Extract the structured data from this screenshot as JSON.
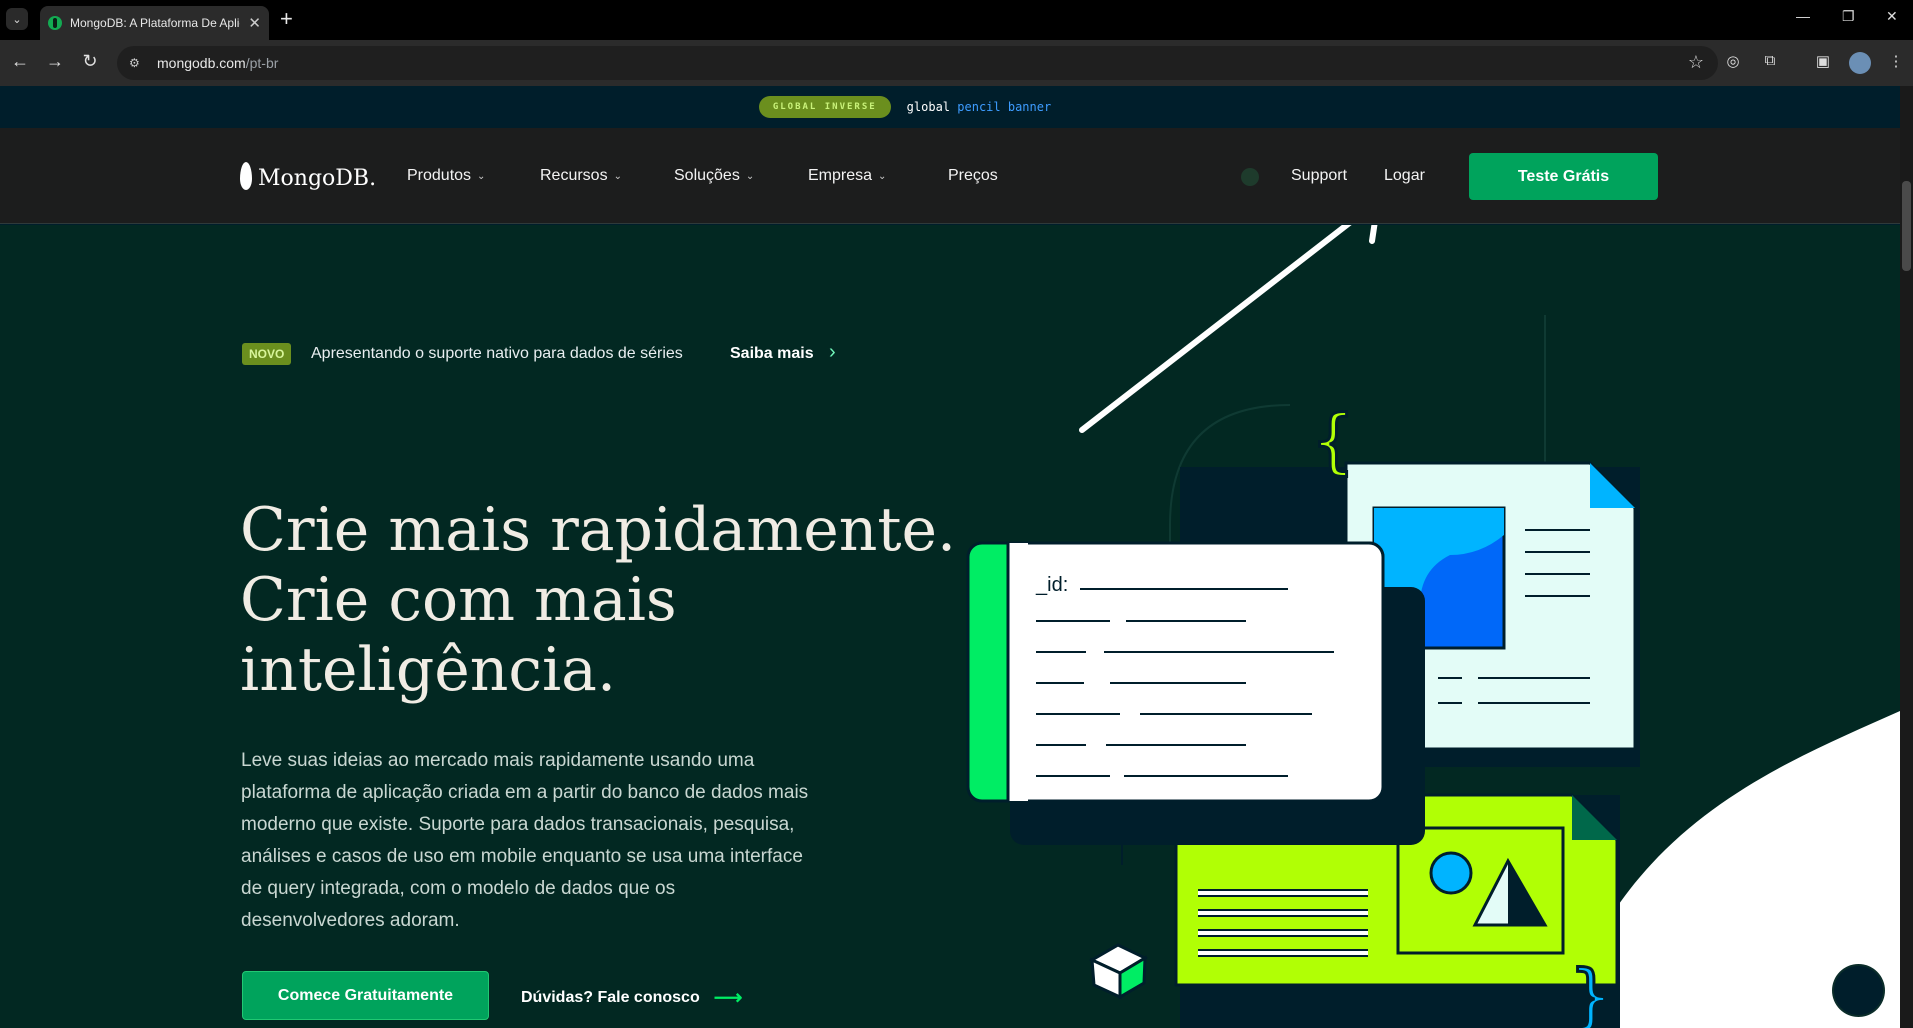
{
  "browser": {
    "tab_title": "MongoDB: A Plataforma De Aplicação",
    "url_host": "mongodb.com",
    "url_path": "/pt-br"
  },
  "pencil_banner": {
    "pill": "GLOBAL INVERSE",
    "text": "global",
    "link": "pencil banner"
  },
  "nav": {
    "logo": "MongoDB.",
    "menu": [
      "Produtos",
      "Recursos",
      "Soluções",
      "Empresa",
      "Preços"
    ],
    "support": "Support",
    "login": "Logar",
    "cta": "Teste Grátis"
  },
  "announcement": {
    "badge": "NOVO",
    "text": "Apresentando o suporte nativo para dados de séries",
    "link": "Saiba mais"
  },
  "hero": {
    "headline_1": "Crie mais rapidamente.",
    "headline_2": "Crie com mais",
    "headline_3": "inteligência.",
    "subtitle": "Leve suas ideias ao mercado mais rapidamente usando uma plataforma de aplicação criada em a partir do banco de dados mais moderno que existe. Suporte para dados transacionais, pesquisa, análises e casos de uso em mobile enquanto se usa uma interface de query integrada, com o modelo de dados que os desenvolvedores adoram.",
    "primary_button": "Comece Gratuitamente",
    "secondary_button": "Dúvidas? Fale conosco"
  },
  "illustration": {
    "id_label": "_id:"
  },
  "colors": {
    "brand_green": "#00a35c",
    "hero_bg": "#022822",
    "lime": "#b1ff05",
    "accent_green": "#00ed64"
  }
}
